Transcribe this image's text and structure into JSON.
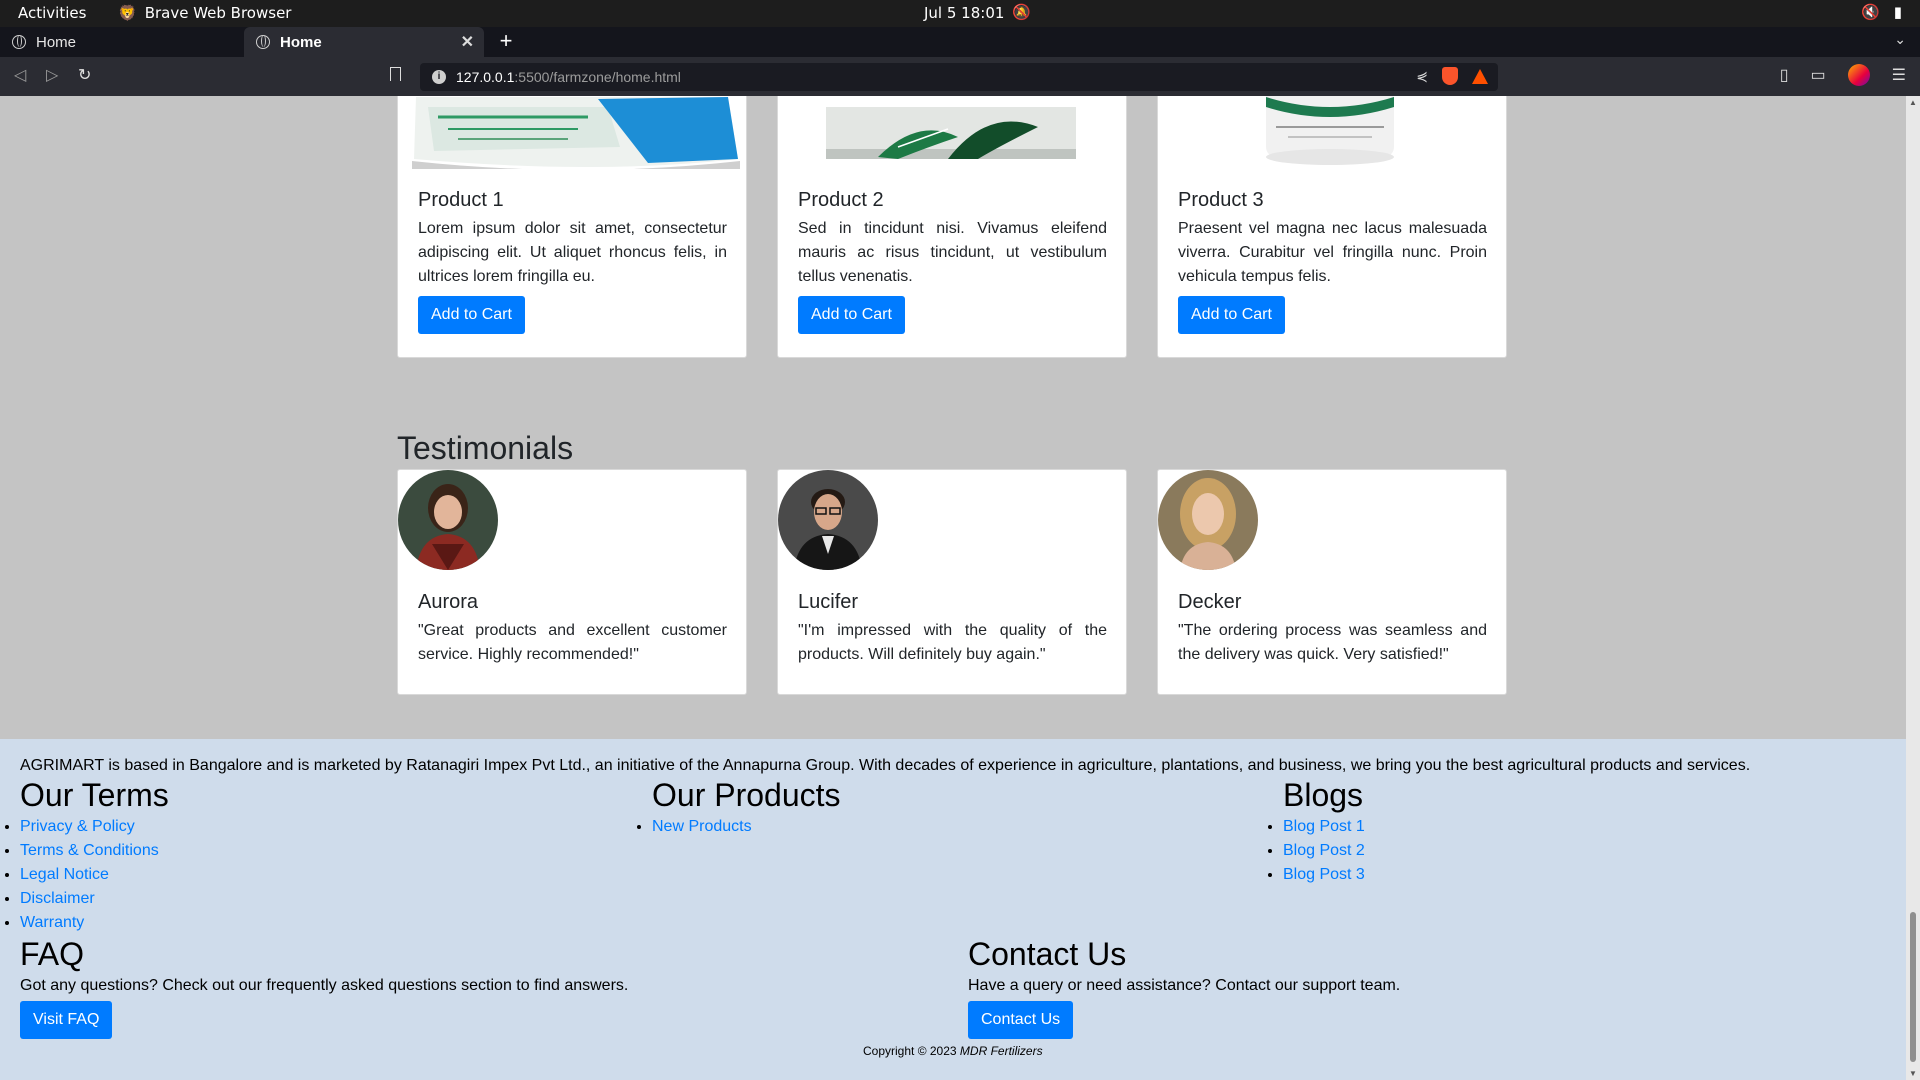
{
  "system": {
    "activities": "Activities",
    "app_name": "Brave Web Browser",
    "clock": "Jul 5  18:01"
  },
  "browser": {
    "tabs": [
      {
        "label": "Home",
        "active": false
      },
      {
        "label": "Home",
        "active": true
      }
    ],
    "url_host": "127.0.0.1",
    "url_path": ":5500/farmzone/home.html"
  },
  "products": [
    {
      "title": "Product 1",
      "text": "Lorem ipsum dolor sit amet, consectetur adipiscing elit. Ut aliquet rhoncus felis, in ultrices lorem fringilla eu.",
      "button": "Add to Cart"
    },
    {
      "title": "Product 2",
      "text": "Sed in tincidunt nisi. Vivamus eleifend mauris ac risus tincidunt, ut vestibulum tellus venenatis.",
      "button": "Add to Cart"
    },
    {
      "title": "Product 3",
      "text": "Praesent vel magna nec lacus malesuada viverra. Curabitur vel fringilla nunc. Proin vehicula tempus felis.",
      "button": "Add to Cart"
    }
  ],
  "testimonials": {
    "title": "Testimonials",
    "items": [
      {
        "name": "Aurora",
        "quote": "\"Great products and excellent customer service. Highly recommended!\""
      },
      {
        "name": "Lucifer",
        "quote": "\"I'm impressed with the quality of the products. Will definitely buy again.\""
      },
      {
        "name": "Decker",
        "quote": "\"The ordering process was seamless and the delivery was quick. Very satisfied!\""
      }
    ]
  },
  "footer": {
    "about": "AGRIMART is based in Bangalore and is marketed by Ratanagiri Impex Pvt Ltd., an initiative of the Annapurna Group. With decades of experience in agriculture, plantations, and business, we bring you the best agricultural products and services.",
    "terms": {
      "title": "Our Terms",
      "links": [
        "Privacy & Policy",
        "Terms & Conditions",
        "Legal Notice",
        "Disclaimer",
        "Warranty"
      ]
    },
    "our_products": {
      "title": "Our Products",
      "links": [
        "New Products"
      ]
    },
    "blogs": {
      "title": "Blogs",
      "links": [
        "Blog Post 1",
        "Blog Post 2",
        "Blog Post 3"
      ]
    },
    "faq": {
      "title": "FAQ",
      "text": "Got any questions? Check out our frequently asked questions section to find answers.",
      "button": "Visit FAQ"
    },
    "contact": {
      "title": "Contact Us",
      "text": "Have a query or need assistance? Contact our support team.",
      "button": "Contact Us"
    },
    "copyright_prefix": "Copyright © 2023 ",
    "copyright_company": "MDR Fertilizers"
  },
  "colors": {
    "page_bg": "#c4c4c4",
    "footer_bg": "#cfdceb",
    "primary": "#007bff",
    "link": "#007bff"
  }
}
